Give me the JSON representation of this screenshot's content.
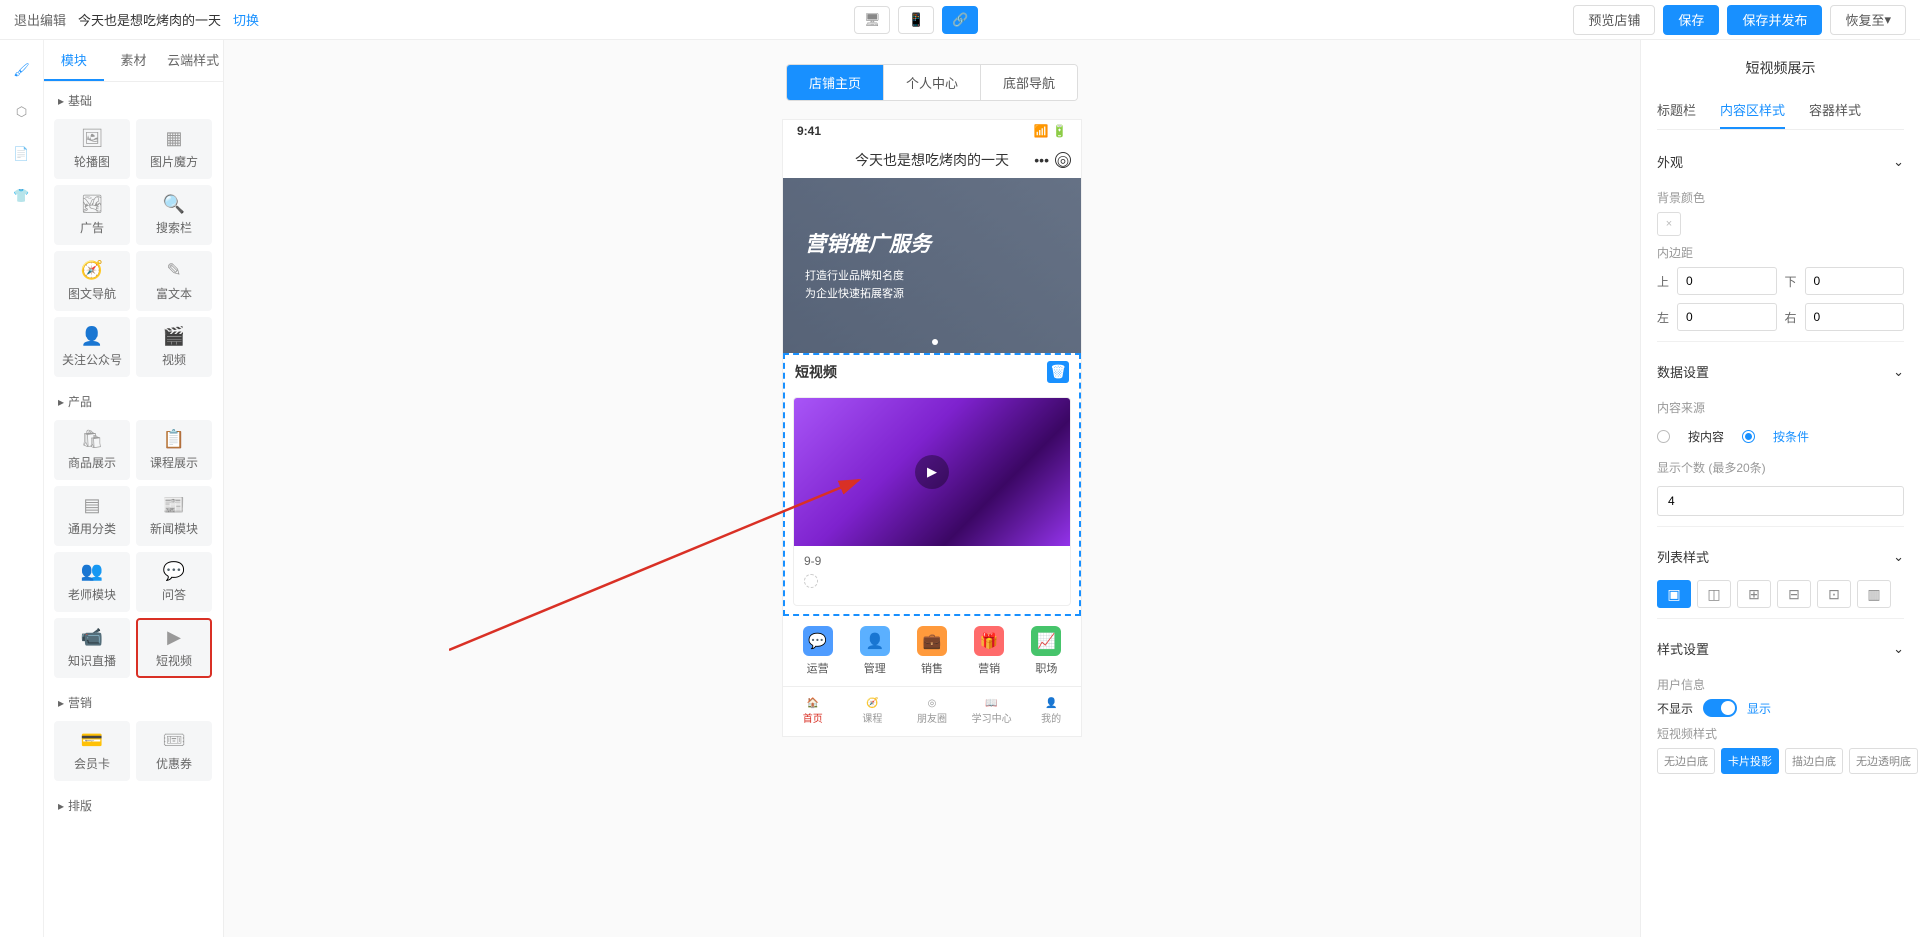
{
  "topbar": {
    "exit": "退出编辑",
    "title": "今天也是想吃烤肉的一天",
    "switch": "切换",
    "preview": "预览店铺",
    "save": "保存",
    "publish": "保存并发布",
    "restore": "恢复至"
  },
  "panel": {
    "tabs": [
      "模块",
      "素材",
      "云端样式"
    ],
    "sections": {
      "basic": "基础",
      "product": "产品",
      "marketing": "营销",
      "layout": "排版"
    },
    "modules": {
      "basic": [
        "轮播图",
        "图片魔方",
        "广告",
        "搜索栏",
        "图文导航",
        "富文本",
        "关注公众号",
        "视频"
      ],
      "product": [
        "商品展示",
        "课程展示",
        "通用分类",
        "新闻模块",
        "老师模块",
        "问答",
        "知识直播",
        "短视频"
      ],
      "marketing": [
        "会员卡",
        "优惠券"
      ]
    }
  },
  "canvas": {
    "tabs": [
      "店铺主页",
      "个人中心",
      "底部导航"
    ]
  },
  "phone": {
    "time": "9:41",
    "title": "今天也是想吃烤肉的一天",
    "banner": {
      "headline": "营销推广服务",
      "line1": "打造行业品牌知名度",
      "line2": "为企业快速拓展客源"
    },
    "video_block_title": "短视频",
    "video_date": "9-9",
    "features": [
      {
        "label": "运营",
        "color": "#4f9cff"
      },
      {
        "label": "管理",
        "color": "#5bb0ff"
      },
      {
        "label": "销售",
        "color": "#ff9a3c"
      },
      {
        "label": "营销",
        "color": "#ff6b6b"
      },
      {
        "label": "职场",
        "color": "#46c46b"
      }
    ],
    "tabbar": [
      "首页",
      "课程",
      "朋友圈",
      "学习中心",
      "我的"
    ]
  },
  "inspector": {
    "title": "短视频展示",
    "tabs": [
      "标题栏",
      "内容区样式",
      "容器样式"
    ],
    "appearance": "外观",
    "bg_label": "背景颜色",
    "padding_label": "内边距",
    "pad": {
      "top_l": "上",
      "top": "0",
      "bottom_l": "下",
      "bottom": "0",
      "left_l": "左",
      "left": "0",
      "right_l": "右",
      "right": "0"
    },
    "data_section": "数据设置",
    "source_label": "内容来源",
    "source_opts": [
      "按内容",
      "按条件"
    ],
    "count_label": "显示个数 (最多20条)",
    "count_value": "4",
    "list_style": "列表样式",
    "style_section": "样式设置",
    "userinfo_label": "用户信息",
    "userinfo_off": "不显示",
    "userinfo_on": "显示",
    "video_style_label": "短视频样式",
    "video_styles": [
      "无边白底",
      "卡片投影",
      "描边白底",
      "无边透明底"
    ]
  }
}
